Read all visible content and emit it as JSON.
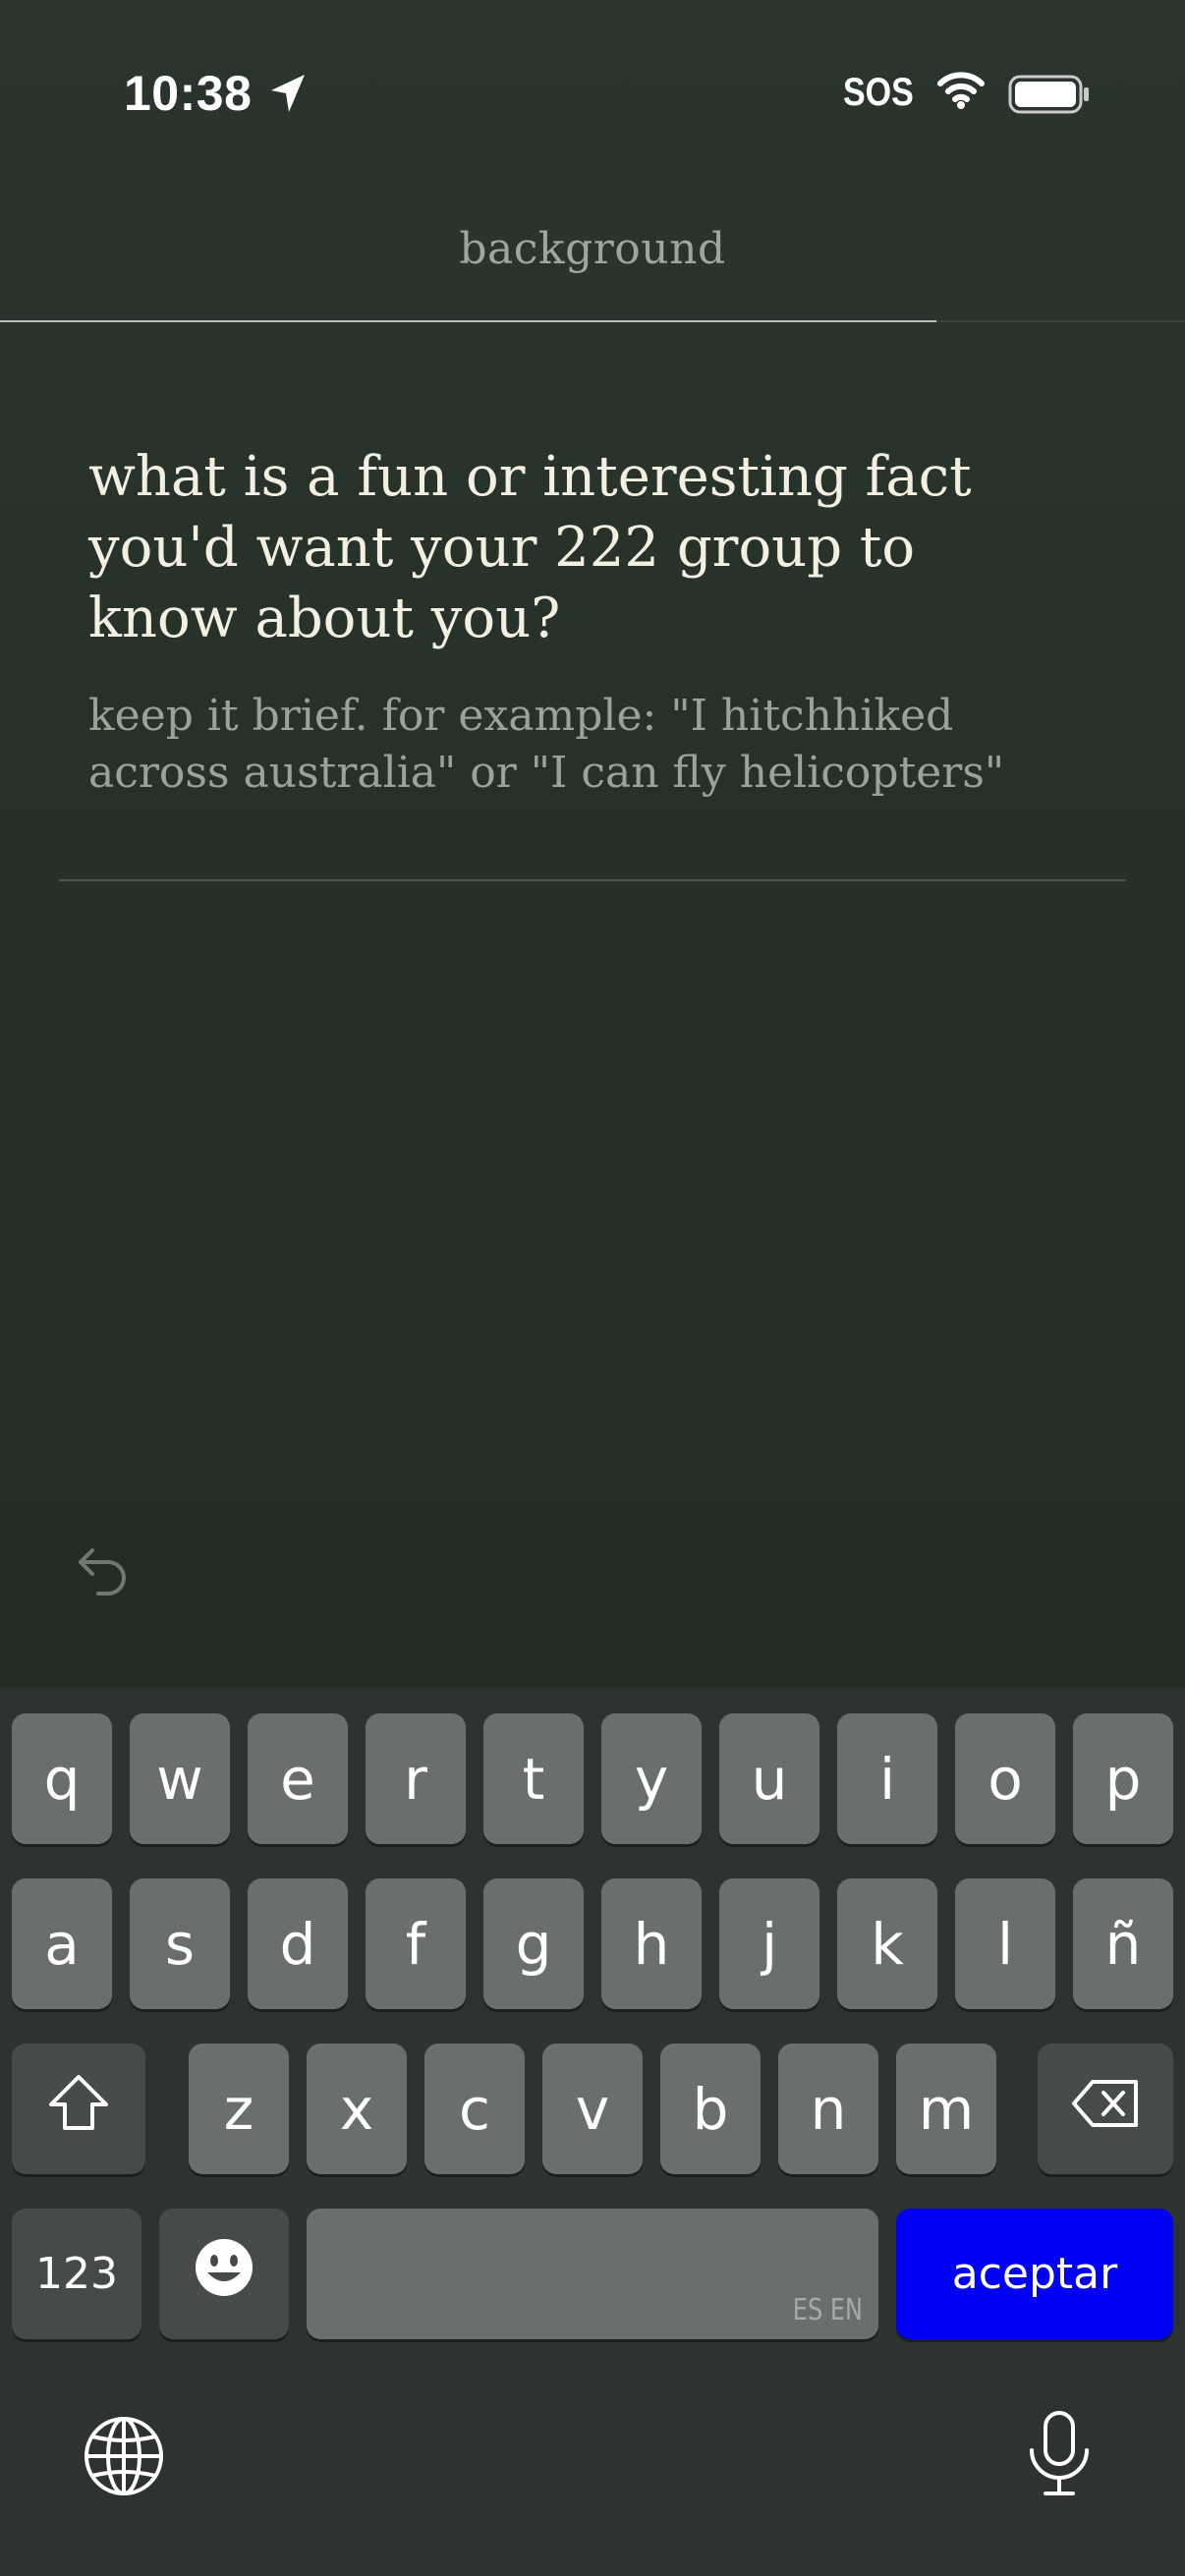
{
  "status_bar": {
    "time": "10:38",
    "carrier": "SOS"
  },
  "header": {
    "title": "background",
    "progress": 0.79
  },
  "question": {
    "text": "what is a fun or interesting fact you'd want your 222 group to know about you?",
    "hint": "keep it brief. for example: \"I hitchhiked across australia\" or \"I can fly helicopters\""
  },
  "keyboard": {
    "row1": [
      "q",
      "w",
      "e",
      "r",
      "t",
      "y",
      "u",
      "i",
      "o",
      "p"
    ],
    "row2": [
      "a",
      "s",
      "d",
      "f",
      "g",
      "h",
      "j",
      "k",
      "l",
      "ñ"
    ],
    "row3": [
      "z",
      "x",
      "c",
      "v",
      "b",
      "n",
      "m"
    ],
    "numbers_label": "123",
    "space_lang": "ES EN",
    "accept_label": "aceptar",
    "accent_color": "#0000f2"
  },
  "icons": [
    "location-arrow-icon",
    "wifi-icon",
    "battery-icon",
    "undo-arrow-icon",
    "shift-icon",
    "backspace-icon",
    "emoji-icon",
    "globe-icon",
    "microphone-icon"
  ]
}
